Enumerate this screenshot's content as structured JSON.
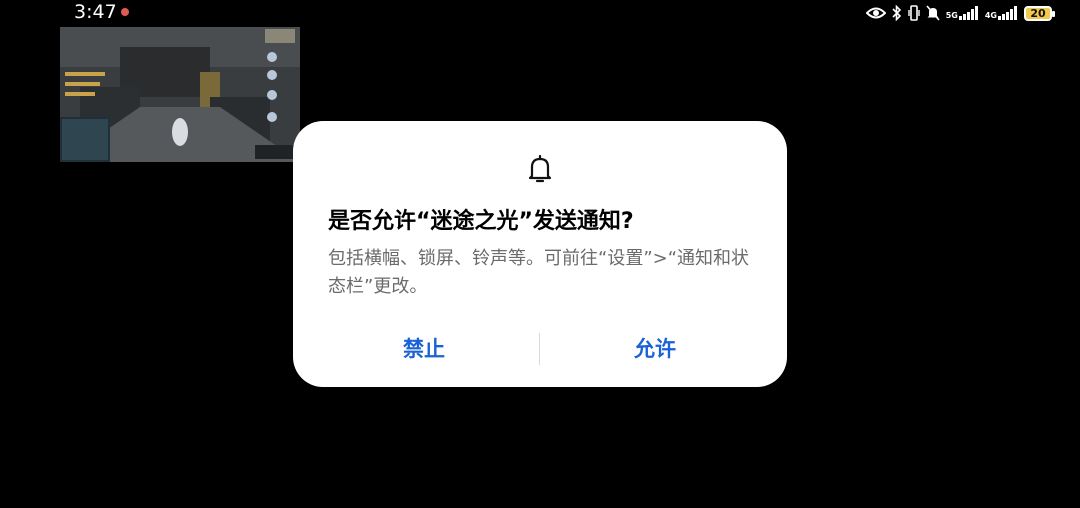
{
  "status_bar": {
    "time": "3:47",
    "icons": [
      "eye-icon",
      "bluetooth-icon",
      "vibrate-icon",
      "mute-icon",
      "signal-5g-icon",
      "signal-4g-icon",
      "battery-icon"
    ],
    "net1_label": "5G",
    "net2_label": "4G",
    "battery_level": "20"
  },
  "floating_window": {
    "content": "game-screen-thumbnail"
  },
  "dialog": {
    "icon": "bell-icon",
    "title": "是否允许“迷途之光”发送通知?",
    "message": "包括横幅、锁屏、铃声等。可前往“设置”>“通知和状态栏”更改。",
    "deny_label": "禁止",
    "allow_label": "允许",
    "button_color": "#1a62d6"
  }
}
